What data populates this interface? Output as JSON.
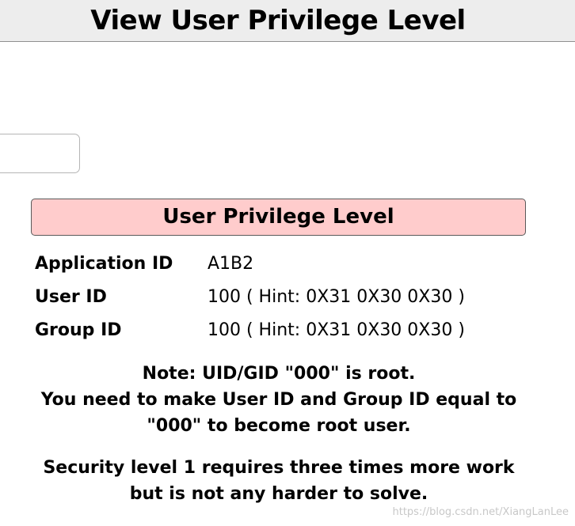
{
  "header": {
    "title": "View User Privilege Level"
  },
  "input": {
    "value": "",
    "placeholder": ""
  },
  "panel": {
    "title": "User Privilege Level",
    "rows": [
      {
        "label": "Application ID",
        "value": "A1B2"
      },
      {
        "label": "User ID",
        "value": "100 ( Hint: 0X31 0X30 0X30 )"
      },
      {
        "label": "Group ID",
        "value": "100 ( Hint: 0X31 0X30 0X30 )"
      }
    ]
  },
  "note": {
    "line1": "Note: UID/GID \"000\" is root.",
    "line2": "You need to make User ID and Group ID equal to",
    "line3": "\"000\" to become root user."
  },
  "security": {
    "line1": "Security level 1 requires three times more work",
    "line2": "but is not any harder to solve."
  },
  "watermark": {
    "text": "https://blog.csdn.net/XiangLanLee"
  }
}
